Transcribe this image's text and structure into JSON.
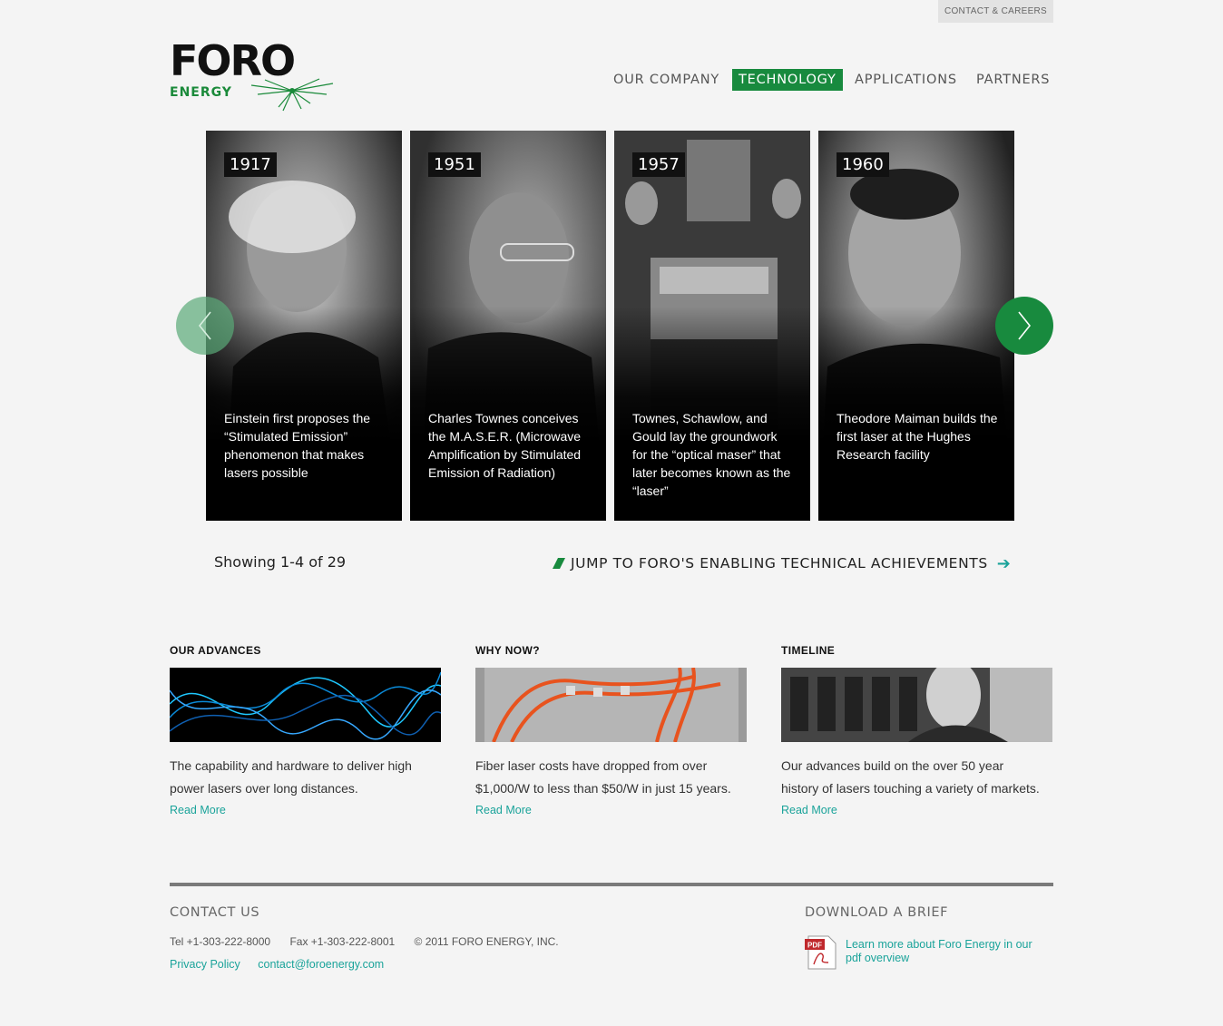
{
  "topbar": {
    "contact_careers": "CONTACT & CAREERS"
  },
  "logo": {
    "wordmark": "FORO",
    "subword": "ENERGY"
  },
  "nav": {
    "items": [
      {
        "label": "OUR COMPANY"
      },
      {
        "label": "TECHNOLOGY",
        "active": true
      },
      {
        "label": "APPLICATIONS"
      },
      {
        "label": "PARTNERS"
      }
    ]
  },
  "timeline": {
    "cards": [
      {
        "year": "1917",
        "caption": "Einstein first proposes the “Stimulated Emission” phenomenon that makes lasers possible"
      },
      {
        "year": "1951",
        "caption": "Charles Townes conceives the M.A.S.E.R. (Microwave Amplification by Stimulated Emission of Radiation)"
      },
      {
        "year": "1957",
        "caption": "Townes, Schawlow, and Gould lay the groundwork for the “optical maser” that later becomes known as the “laser”"
      },
      {
        "year": "1960",
        "caption": "Theodore Maiman builds the first laser at the Hughes Research facility"
      }
    ],
    "showing": "Showing 1-4 of 29",
    "jump_label": "JUMP TO FORO'S ENABLING TECHNICAL ACHIEVEMENTS",
    "jump_arrow": "➔"
  },
  "features": [
    {
      "title": "OUR ADVANCES",
      "text": "The capability and hardware to deliver high power lasers over long distances.",
      "more": "Read More"
    },
    {
      "title": "WHY NOW?",
      "text": "Fiber laser costs have dropped from over $1,000/W to less than $50/W in just 15 years.",
      "more": "Read More"
    },
    {
      "title": "TIMELINE",
      "text": "Our advances build on the over 50 year history of lasers touching a variety of markets.",
      "more": "Read More"
    }
  ],
  "footer": {
    "contact_heading": "CONTACT US",
    "tel": "Tel +1-303-222-8000",
    "fax": "Fax +1-303-222-8001",
    "copyright": "© 2011 FORO ENERGY, INC.",
    "privacy": "Privacy Policy",
    "email": "contact@foroenergy.com",
    "brief_heading": "DOWNLOAD A BRIEF",
    "brief_link": "Learn more about Foro Energy in our pdf overview",
    "pdf_badge": "PDF"
  },
  "colors": {
    "brand_green": "#188a3e",
    "link_teal": "#1aa39a"
  },
  "icons": {
    "prev": "chevron-left-icon",
    "next": "chevron-right-icon",
    "pdf": "pdf-icon"
  }
}
